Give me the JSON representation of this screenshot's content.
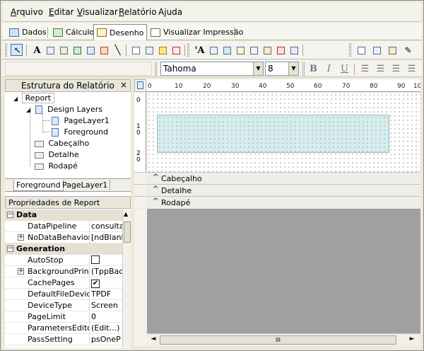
{
  "menu": [
    "Arquivo",
    "Editar",
    "Visualizar",
    "Relatório",
    "Ajuda"
  ],
  "menu_hotkeys": [
    "A",
    "E",
    "V",
    "R",
    "j"
  ],
  "tabs": [
    {
      "label": "Dados",
      "icon": "data-tables-icon"
    },
    {
      "label": "Cálculo",
      "icon": "calculator-icon"
    },
    {
      "label": "Desenho",
      "icon": "design-pencil-icon",
      "active": true
    },
    {
      "label": "Visualizar Impressão",
      "icon": "print-preview-icon"
    }
  ],
  "toolbar1": {
    "text_glyph": "A",
    "text_glyph2": "'A"
  },
  "font": {
    "name": "Tahoma",
    "size": "8",
    "bold": "B",
    "italic": "I",
    "underline": "U"
  },
  "tree": {
    "title": "Estrutura do Relatório",
    "close": "×",
    "items": [
      "Report",
      "Design Layers",
      "PageLayer1",
      "Foreground",
      "Cabeçalho",
      "Detalhe",
      "Rodapé"
    ]
  },
  "layer_tabs": [
    "Foreground",
    "PageLayer1"
  ],
  "props": {
    "title": "Propriedades de Report",
    "categories": [
      {
        "label": "Data",
        "rows": [
          {
            "name": "DataPipeline",
            "value": "consulta"
          },
          {
            "name": "NoDataBehaviors",
            "value": "[ndBlank",
            "expand": true
          }
        ]
      },
      {
        "label": "Generation",
        "rows": [
          {
            "name": "AutoStop",
            "value": ""
          },
          {
            "name": "BackgroundPrintSe",
            "value": "(TppBac",
            "expand": true
          },
          {
            "name": "CachePages",
            "value": "✔"
          },
          {
            "name": "DefaultFileDevice",
            "value": "TPDF"
          },
          {
            "name": "DeviceType",
            "value": "Screen"
          },
          {
            "name": "PageLimit",
            "value": "0"
          },
          {
            "name": "ParametersEditor",
            "value": "(Edit...)"
          },
          {
            "name": "PassSetting",
            "value": "psOneP"
          }
        ]
      }
    ]
  },
  "ruler": {
    "h_labels": [
      "0",
      "10",
      "20",
      "30",
      "40",
      "50",
      "60",
      "70",
      "80",
      "90",
      "10"
    ],
    "v_labels": [
      "0",
      "1\n0",
      "2\n0"
    ]
  },
  "bands": [
    "Cabeçalho",
    "Detalhe",
    "Rodapé"
  ],
  "band_caret": "^",
  "scroll": {
    "left_arrow": "◄",
    "right_arrow": "►",
    "grip": "III"
  },
  "colors": {
    "region": "#d7ecec",
    "gray_area": "#a0a0a0",
    "accent": "#316ac5"
  }
}
